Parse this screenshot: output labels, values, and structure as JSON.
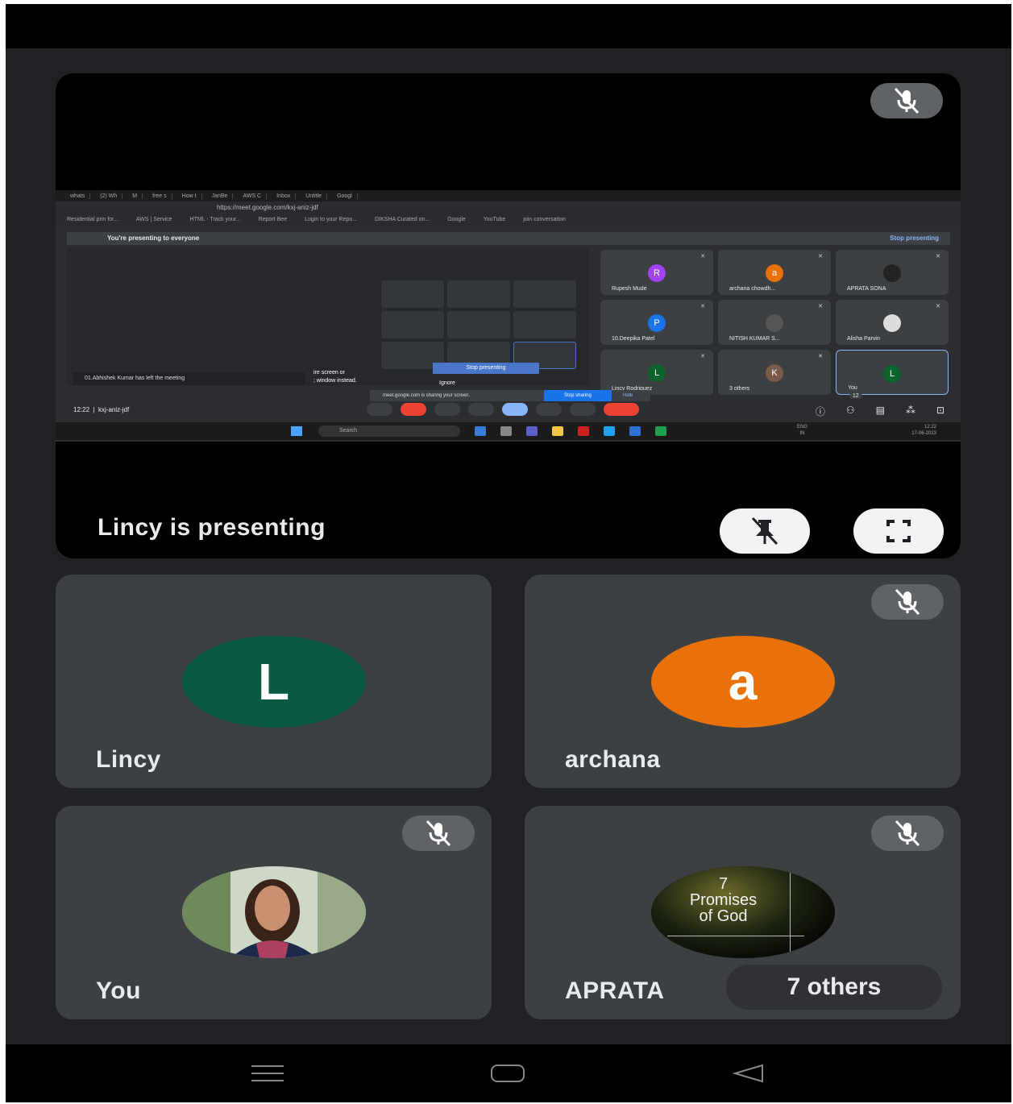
{
  "presentation": {
    "label": "Lincy is presenting",
    "shared_screen": {
      "browser_tabs": [
        "whats",
        "(2) Wh",
        "M",
        "free s",
        "How t",
        "JanBe",
        "AWS C",
        "Inbox",
        "Untitle",
        "Googl"
      ],
      "url": "https://meet.google.com/kxj-aniz-jdf",
      "bookmarks": [
        "Residential prin for...",
        "AWS | Service",
        "HTML - Track your...",
        "Report Bee",
        "Login to your Repo...",
        "DIKSHA Curated on...",
        "Google",
        "YouTube",
        "join conversation"
      ],
      "banner": "You're presenting to everyone",
      "banner_stop": "Stop presenting",
      "notice": "01.Abhishek Kumar has left the meeting",
      "overlay_text_1": "ire screen or",
      "overlay_text_2": "; window instead.",
      "stop_presenting_btn": "Stop presenting",
      "ignore": "Ignore",
      "share_bar_text": "meet.google.com is sharing your screen.",
      "stop_sharing": "Stop sharing",
      "hide": "Hide",
      "meeting_time": "12:22",
      "meeting_code": "kxj-aniz-jdf",
      "participant_count": "12",
      "taskbar_search": "Search",
      "taskbar_lang_1": "ENG",
      "taskbar_lang_2": "IN",
      "taskbar_time": "12:22",
      "taskbar_date": "17-06-2023",
      "mini_participants": [
        {
          "initial": "R",
          "name": "Rupesh Mude",
          "color": "#a142f4"
        },
        {
          "initial": "a",
          "name": "archana chowdh...",
          "color": "#e8710a"
        },
        {
          "initial": "",
          "name": "APRATA SONA",
          "color": "#222"
        },
        {
          "initial": "P",
          "name": "10.Deepika Patel",
          "color": "#1a73e8"
        },
        {
          "initial": "",
          "name": "NITISH KUMAR S...",
          "color": "#555"
        },
        {
          "initial": "",
          "name": "Alisha Parvin",
          "color": "#ddd"
        },
        {
          "initial": "L",
          "name": "Lincy Rodriguez",
          "color": "#0d652d"
        },
        {
          "initial": "K",
          "name": "3 others",
          "color": "#7a5a4a"
        },
        {
          "initial": "L",
          "name": "You",
          "color": "#0d652d"
        }
      ]
    }
  },
  "tiles": {
    "lincy": {
      "name": "Lincy",
      "initial": "L",
      "color": "#0b5a44"
    },
    "archana": {
      "name": "archana",
      "initial": "a",
      "color": "#e8710a"
    },
    "you": {
      "name": "You"
    },
    "aprata": {
      "name": "APRATA",
      "others": "7 others",
      "avatar_text_1": "7",
      "avatar_text_2": "Promises",
      "avatar_text_3": "of God"
    }
  },
  "colors": {
    "tile_bg": "#3c4043",
    "app_bg": "#202124",
    "mute_badge": "#5f6368"
  }
}
